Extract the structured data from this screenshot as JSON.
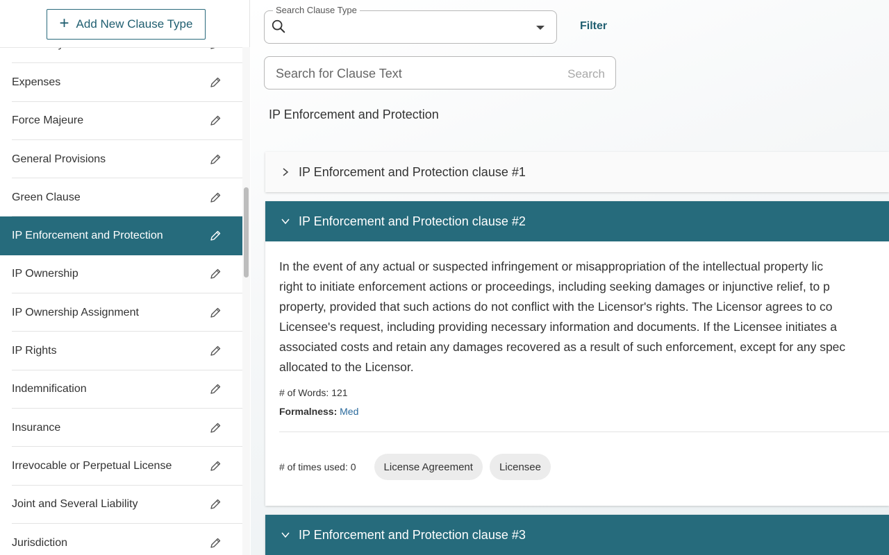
{
  "sidebar": {
    "add_button_label": "Add New Clause Type",
    "items": [
      {
        "label": "Exclusivity",
        "active": false
      },
      {
        "label": "Expenses",
        "active": false
      },
      {
        "label": "Force Majeure",
        "active": false
      },
      {
        "label": "General Provisions",
        "active": false
      },
      {
        "label": "Green Clause",
        "active": false
      },
      {
        "label": "IP Enforcement and Protection",
        "active": true
      },
      {
        "label": "IP Ownership",
        "active": false
      },
      {
        "label": "IP Ownership Assignment",
        "active": false
      },
      {
        "label": "IP Rights",
        "active": false
      },
      {
        "label": "Indemnification",
        "active": false
      },
      {
        "label": "Insurance",
        "active": false
      },
      {
        "label": "Irrevocable or Perpetual License",
        "active": false
      },
      {
        "label": "Joint and Several Liability",
        "active": false
      },
      {
        "label": "Jurisdiction",
        "active": false
      }
    ]
  },
  "search": {
    "clause_type_label": "Search Clause Type",
    "filter_label": "Filter",
    "text_placeholder": "Search for Clause Text",
    "text_button": "Search"
  },
  "main": {
    "section_title": "IP Enforcement and Protection",
    "clauses": [
      {
        "title": "IP Enforcement and Protection clause #1",
        "open": false
      },
      {
        "title": "IP Enforcement and Protection clause #2",
        "open": true,
        "lines": [
          "In the event of any actual or suspected infringement or misappropriation of the intellectual property lic",
          "right to initiate enforcement actions or proceedings, including seeking damages or injunctive relief, to p",
          "property, provided that such actions do not conflict with the Licensor's rights. The Licensor agrees to co",
          "Licensee's request, including providing necessary information and documents. If the Licensee initiates a",
          "associated costs and retain any damages recovered as a result of such enforcement, except for any spec",
          "allocated to the Licensor."
        ],
        "words_label": "# of Words: 121",
        "formalness_label": "Formalness:",
        "formalness_value": "Med",
        "times_used_label": "# of times used: 0",
        "tags": [
          "License Agreement",
          "Licensee"
        ]
      },
      {
        "title": "IP Enforcement and Protection clause #3",
        "open": true
      }
    ]
  },
  "colors": {
    "accent": "#266b7c",
    "link": "#2a6a9c"
  }
}
